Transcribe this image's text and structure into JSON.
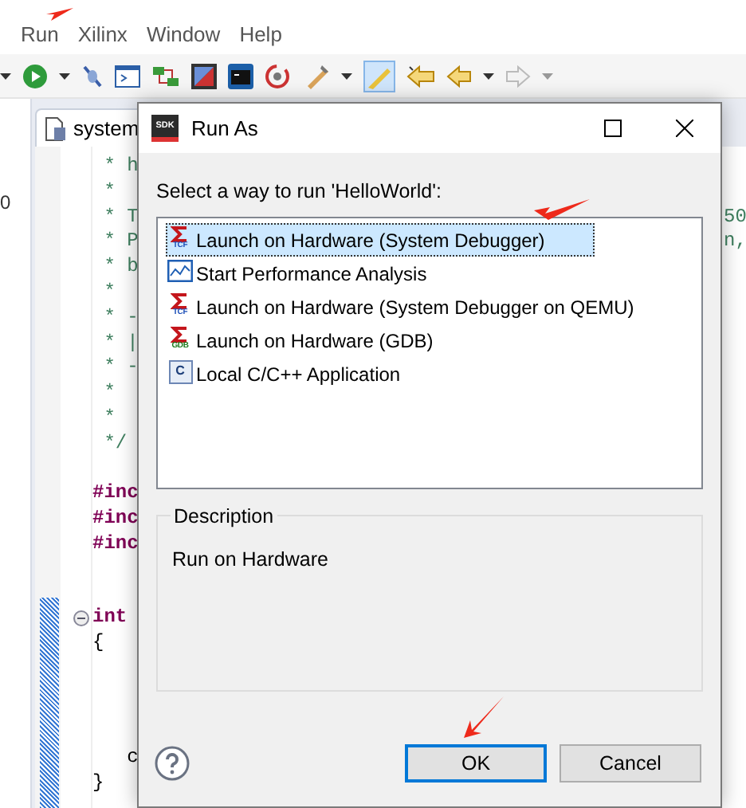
{
  "menu": [
    {
      "label": "Run"
    },
    {
      "label": "Xilinx"
    },
    {
      "label": "Window"
    },
    {
      "label": "Help"
    }
  ],
  "side_panel": {
    "text": "0"
  },
  "editor": {
    "tab": "system",
    "blocks": [
      {
        "lines": [
          {
            "kind": "comment",
            "text": " * h"
          },
          {
            "kind": "comment",
            "text": " *"
          },
          {
            "kind": "comment",
            "text": " * T",
            "tail": "50"
          },
          {
            "kind": "comment",
            "text": " * P",
            "tail": "n,"
          },
          {
            "kind": "comment",
            "text": " * b"
          },
          {
            "kind": "comment",
            "text": " *"
          },
          {
            "kind": "comment",
            "text": " * -"
          },
          {
            "kind": "comment",
            "text": " * |"
          },
          {
            "kind": "comment",
            "text": " * -"
          },
          {
            "kind": "comment",
            "text": " *"
          },
          {
            "kind": "comment",
            "text": " *"
          },
          {
            "kind": "comment",
            "text": " */"
          }
        ]
      },
      {
        "lines": [
          {
            "kind": "directive",
            "text": "#inc"
          },
          {
            "kind": "directive",
            "text": "#inc"
          },
          {
            "kind": "directive",
            "text": "#inc"
          }
        ]
      },
      {
        "lines": [
          {
            "kind": "keyword",
            "text": "int",
            "fold": true
          },
          {
            "kind": "plain",
            "text": "{"
          }
        ]
      },
      {
        "lines": [
          {
            "kind": "plain",
            "text": "   c"
          }
        ]
      },
      {
        "lines": [
          {
            "kind": "plain",
            "text": "}"
          }
        ]
      }
    ]
  },
  "dialog": {
    "app_icon_text": "SDK",
    "title": "Run As",
    "prompt": "Select a way to run 'HelloWorld':",
    "items": [
      {
        "kind": "tcf",
        "icon_label": "TCF",
        "label": "Launch on Hardware (System Debugger)",
        "selected": true
      },
      {
        "kind": "perf",
        "label": "Start Performance Analysis",
        "selected": false
      },
      {
        "kind": "tcf",
        "icon_label": "TCF",
        "label": "Launch on Hardware (System Debugger on QEMU)",
        "selected": false
      },
      {
        "kind": "gdb",
        "icon_label": "GDB",
        "label": "Launch on Hardware (GDB)",
        "selected": false
      },
      {
        "kind": "capp",
        "icon_label": "C",
        "label": "Local C/C++ Application",
        "selected": false
      }
    ],
    "description": {
      "legend": "Description",
      "text": "Run on Hardware"
    },
    "buttons": [
      {
        "label": "OK",
        "default": true
      },
      {
        "label": "Cancel",
        "default": false
      }
    ]
  }
}
